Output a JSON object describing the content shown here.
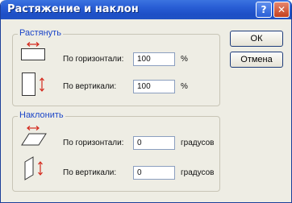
{
  "window": {
    "title": "Растяжение и наклон",
    "help_glyph": "?",
    "close_glyph": "✕"
  },
  "scale_group": {
    "legend": "Растянуть",
    "horizontal": {
      "label": "По горизонтали:",
      "value": "100",
      "unit": "%"
    },
    "vertical": {
      "label": "По вертикали:",
      "value": "100",
      "unit": "%"
    }
  },
  "skew_group": {
    "legend": "Наклонить",
    "horizontal": {
      "label": "По горизонтали:",
      "value": "0",
      "unit": "градусов"
    },
    "vertical": {
      "label": "По вертикали:",
      "value": "0",
      "unit": "градусов"
    }
  },
  "buttons": {
    "ok": "ОК",
    "cancel": "Отмена"
  },
  "icons": {
    "stretch_horizontal": "stretch-horizontal-icon",
    "stretch_vertical": "stretch-vertical-icon",
    "skew_horizontal": "skew-horizontal-icon",
    "skew_vertical": "skew-vertical-icon"
  },
  "colors": {
    "titlebar": "#2a5fd6",
    "legend_text": "#1c46c8",
    "arrow": "#d42a1e",
    "dialog_bg": "#eeede4"
  }
}
